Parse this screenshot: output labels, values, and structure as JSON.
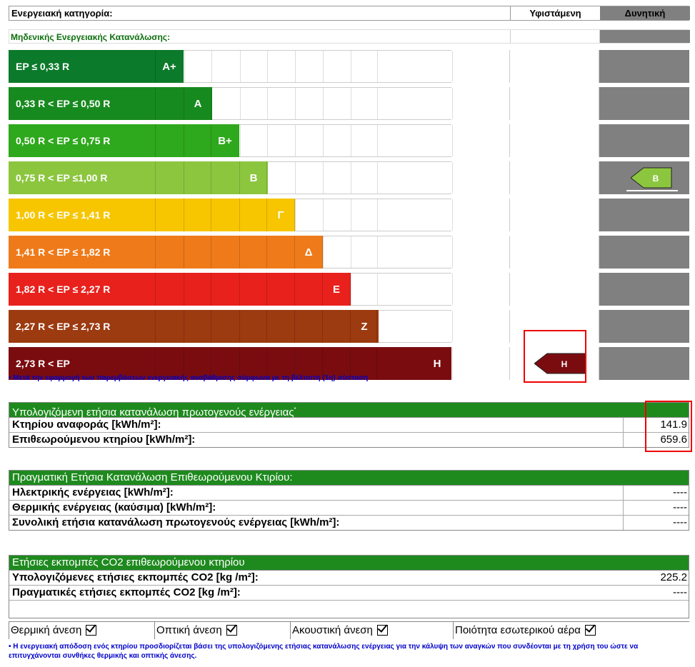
{
  "header": {
    "category_label": "Ενεργειακή κατηγορία:",
    "current_label": "Υφιστάμενη",
    "potential_label": "Δυνητική",
    "nzeb_label": "Μηδενικής Ενεργειακής Κατανάλωσης:"
  },
  "ratings": [
    {
      "range": "EP ≤ 0,33 R",
      "letter": "A+",
      "color": "#0b7a2a",
      "level": 3
    },
    {
      "range": "0,33 R < EP ≤ 0,50 R",
      "letter": "A",
      "color": "#178a1f",
      "level": 4
    },
    {
      "range": "0,50 R < EP ≤ 0,75 R",
      "letter": "B+",
      "color": "#2ea81c",
      "level": 5
    },
    {
      "range": "0,75 R < EP ≤1,00 R",
      "letter": "B",
      "color": "#8cc63f",
      "level": 6
    },
    {
      "range": "1,00 R < EP ≤ 1,41 R",
      "letter": "Γ",
      "color": "#f7c600",
      "level": 7
    },
    {
      "range": "1,41 R < EP ≤ 1,82 R",
      "letter": "Δ",
      "color": "#ef7a1a",
      "level": 8
    },
    {
      "range": "1,82 R < EP ≤ 2,27 R",
      "letter": "Ε",
      "color": "#e8211c",
      "level": 9
    },
    {
      "range": "2,27 R <  EP ≤ 2,73 R",
      "letter": "Ζ",
      "color": "#9c3a10",
      "level": 10
    },
    {
      "range": "2,73 R < EP",
      "letter": "Η",
      "color": "#7a0c10",
      "level": 13
    }
  ],
  "current_rating": {
    "letter": "Η",
    "color": "#7a0c10"
  },
  "potential_rating": {
    "letter": "B",
    "color": "#8cc63f"
  },
  "note_recommendation": "• Μετά την εφαρμογή των παρεμβάσεων ενεργειακής αναβάθμισης σύμφωνα με τη βέλτιστη (1η) σύσταση",
  "calc_table": {
    "title": "Υπολογιζόμενη ετήσια κατανάλωση πρωτογενούς ενέργειας",
    "title_sup": "*",
    "rows": [
      {
        "label": "Κτηρίου αναφοράς [kWh/m²]:",
        "value": "141.9"
      },
      {
        "label": "Επιθεωρούμενου κτηρίου [kWh/m²]:",
        "value": "659.6"
      }
    ]
  },
  "actual_table": {
    "title": "Πραγματική Ετήσια Κατανάλωση Επιθεωρούμενου Κτιρίου:",
    "rows": [
      {
        "label": "Ηλεκτρικής ενέργειας [kWh/m²]:",
        "value": "----"
      },
      {
        "label": "Θερμικής ενέργειας (καύσιμα) [kWh/m²]:",
        "value": "----"
      },
      {
        "label": "Συνολική ετήσια κατανάλωση πρωτογενούς ενέργειας [kWh/m²]:",
        "value": "----"
      }
    ]
  },
  "co2_table": {
    "title": "Ετήσιες εκπομπές CO2 επιθεωρούμενου κτηρίου",
    "rows": [
      {
        "label": "Υπολογιζόμενες ετήσιες εκπομπές CO2 [kg /m²]:",
        "value": "225.2"
      },
      {
        "label": "Πραγματικές ετήσιες εκπομπές CO2 [kg /m²]:",
        "value": "----"
      }
    ]
  },
  "comfort": [
    {
      "label": "Θερμική άνεση",
      "checked": true
    },
    {
      "label": "Οπτική άνεση",
      "checked": true
    },
    {
      "label": "Ακουστική άνεση",
      "checked": true
    },
    {
      "label": "Ποιότητα εσωτερικού αέρα",
      "checked": true
    }
  ],
  "footnote": "• Η ενεργειακή απόδοση ενός κτηρίου προσδιορίζεται βάσει της υπολογιζόμενης ετήσιας κατανάλωσης ενέργειας για την κάλυψη των αναγκών που συνδέονται με τη χρήση του ώστε να επιτυγχάνονται συνθήκες θερμικής και οπτικής άνεσης."
}
